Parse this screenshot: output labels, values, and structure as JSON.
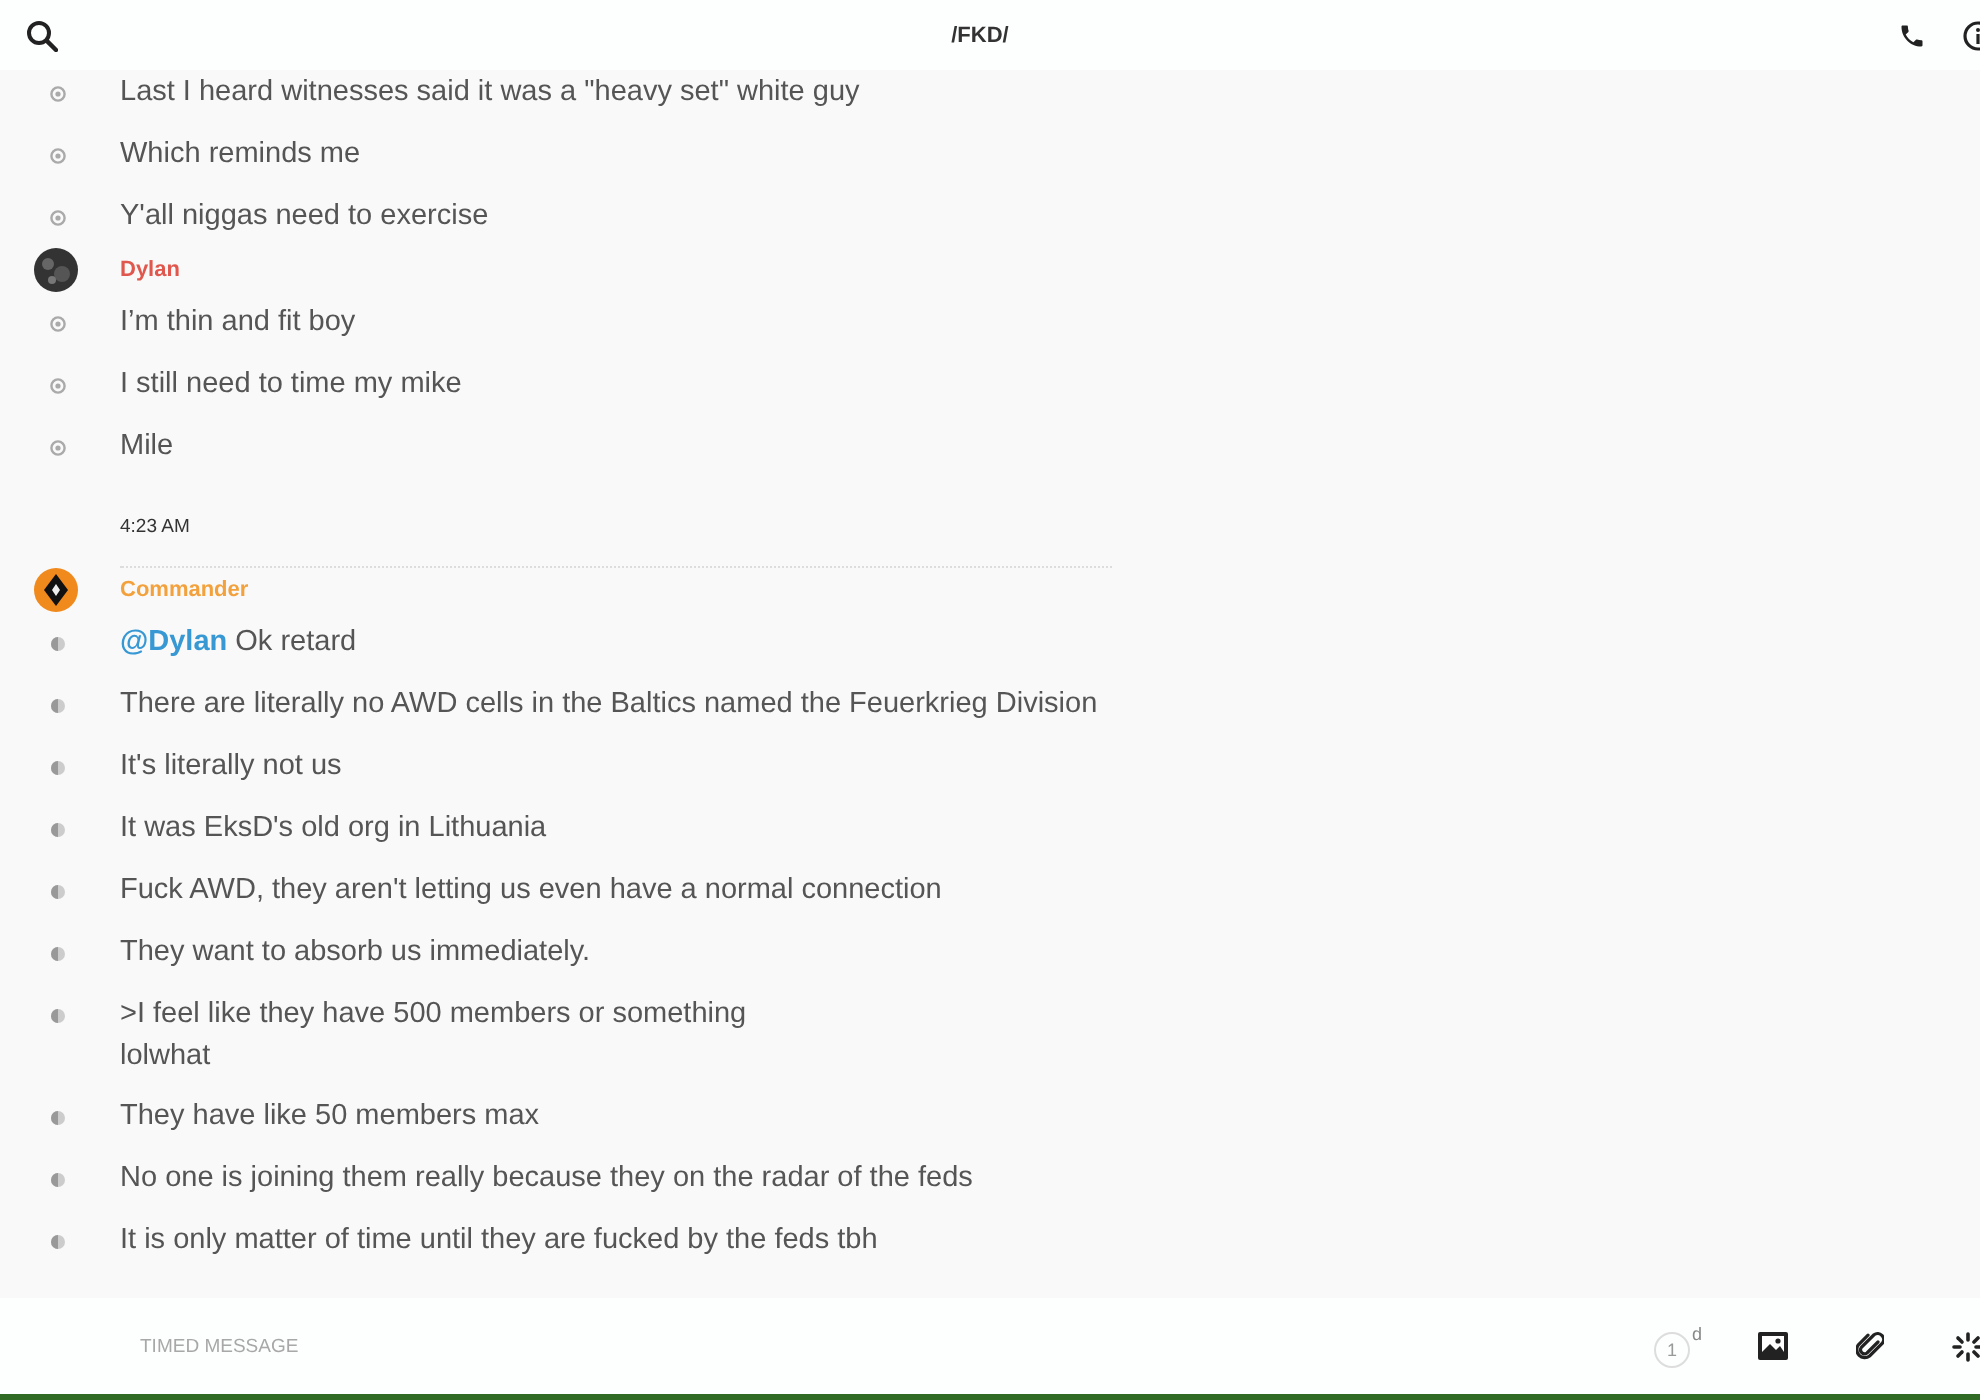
{
  "header": {
    "title": "/FKD/"
  },
  "groups": [
    {
      "kind": "continued",
      "messages": [
        {
          "kind": "read",
          "lines": [
            "Last I heard witnesses said it was a \"heavy set\" white guy"
          ]
        },
        {
          "kind": "read",
          "lines": [
            "Which reminds me"
          ]
        },
        {
          "kind": "read",
          "lines": [
            "Y'all niggas need to exercise"
          ]
        }
      ]
    },
    {
      "kind": "author",
      "author": "Dylan",
      "color": "#e0574d",
      "avatar": {
        "kind": "photo"
      },
      "messages": [
        {
          "kind": "read",
          "lines": [
            "I’m thin and fit boy"
          ]
        },
        {
          "kind": "read",
          "lines": [
            "I still need to time my mike"
          ]
        },
        {
          "kind": "read",
          "lines": [
            "Mile"
          ]
        }
      ]
    },
    {
      "kind": "time",
      "time": "4:23 AM"
    },
    {
      "kind": "author",
      "author": "Commander",
      "color": "#f2a13c",
      "avatar": {
        "kind": "emblem"
      },
      "messages": [
        {
          "kind": "half",
          "mention": "@Dylan",
          "lines": [
            "Ok retard"
          ]
        },
        {
          "kind": "half",
          "lines": [
            "There are literally no AWD cells in the Baltics named the Feuerkrieg Division"
          ]
        },
        {
          "kind": "half",
          "lines": [
            "It's literally not us"
          ]
        },
        {
          "kind": "half",
          "lines": [
            "It was EksD's old org in Lithuania"
          ]
        },
        {
          "kind": "half",
          "lines": [
            "Fuck AWD, they aren't letting us even have a normal connection"
          ]
        },
        {
          "kind": "half",
          "lines": [
            "They want to absorb us immediately."
          ]
        },
        {
          "kind": "half",
          "lines": [
            ">I feel like they have 500 members or something",
            "lolwhat"
          ]
        },
        {
          "kind": "half",
          "lines": [
            "They have like 50 members max"
          ]
        },
        {
          "kind": "half",
          "lines": [
            "No one is joining them really because they on the radar of the feds"
          ]
        },
        {
          "kind": "half",
          "lines": [
            "It is only matter of time until they are fucked by the feds tbh"
          ]
        }
      ]
    }
  ],
  "composer": {
    "placeholder": "TIMED MESSAGE",
    "timer": {
      "value": "1",
      "unit": "d"
    }
  }
}
